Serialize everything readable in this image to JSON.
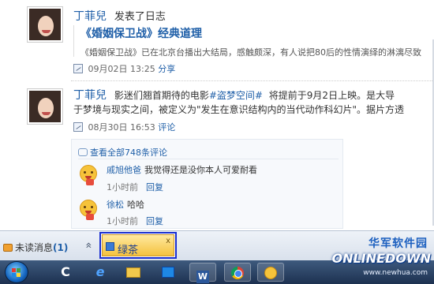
{
  "post1": {
    "user": "丁菲兒",
    "action": "发表了日志",
    "title": "《婚姻保卫战》经典道理",
    "excerpt": "《婚姻保卫战》已在北京台播出大结局，感触颇深，有人说把80后的性情演绎的淋漓尽致",
    "date": "09月02日 13:25",
    "share_label": "分享"
  },
  "post2": {
    "user": "丁菲兒",
    "text_before": "影迷们翘首期待的电影",
    "hashtag": "#盗梦空间#",
    "text_after": "将提前于9月2日上映。是大导",
    "line2": "于梦境与现实之间，被定义为\"发生在意识结构内的当代动作科幻片\"。据片方透",
    "date": "08月30日 16:53",
    "comment_label": "评论"
  },
  "comments": {
    "view_all": "查看全部748条评论",
    "items": [
      {
        "name": "戚旭他爸",
        "text": "我觉得还是没你本人可爱耐看",
        "time": "1小时前",
        "reply": "回复"
      },
      {
        "name": "徐松",
        "text": "哈哈",
        "time": "1小时前",
        "reply": "回复"
      }
    ]
  },
  "chatbar": {
    "unread_label": "未读消息",
    "unread_count": "(1)",
    "expand_glyph": "»",
    "tab_label": "绿茶",
    "tab_close": "x"
  },
  "taskbar": {
    "items": [
      {
        "name": "start-button"
      },
      {
        "name": "c-app",
        "glyph": "C"
      },
      {
        "name": "ie-browser",
        "glyph": "e"
      },
      {
        "name": "folder-app"
      },
      {
        "name": "media-player"
      },
      {
        "name": "word-app",
        "glyph": "W"
      },
      {
        "name": "chrome-app"
      },
      {
        "name": "qq-app"
      }
    ]
  },
  "watermark": {
    "cn": "华军软件园",
    "logo": "ONLINEDOWN",
    "url": "www.newhua.com"
  }
}
